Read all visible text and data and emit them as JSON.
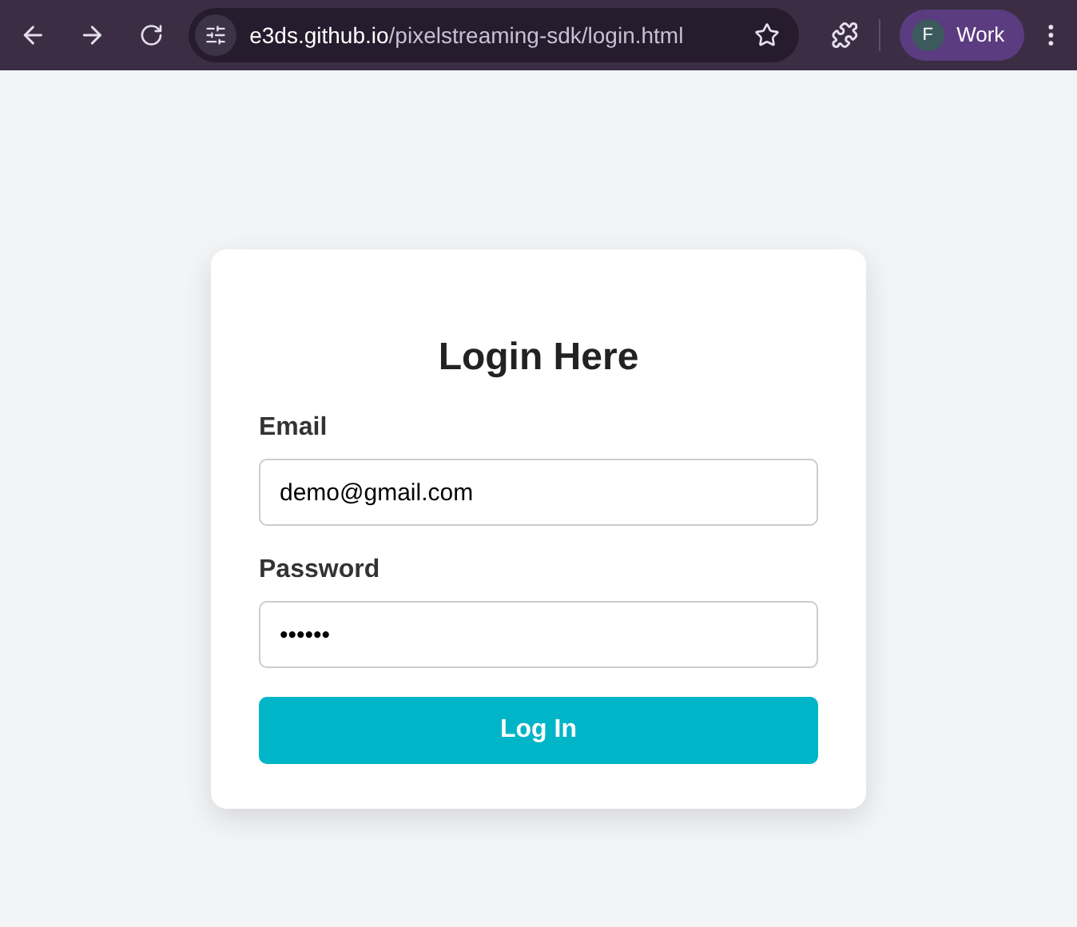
{
  "browser": {
    "url_host": "e3ds.github.io",
    "url_path": "/pixelstreaming-sdk/login.html",
    "profile": {
      "initial": "F",
      "label": "Work"
    }
  },
  "login": {
    "title": "Login Here",
    "fields": [
      {
        "label": "Email",
        "value": "demo@gmail.com"
      },
      {
        "label": "Password",
        "value": "••••••"
      }
    ],
    "button": "Log In"
  }
}
